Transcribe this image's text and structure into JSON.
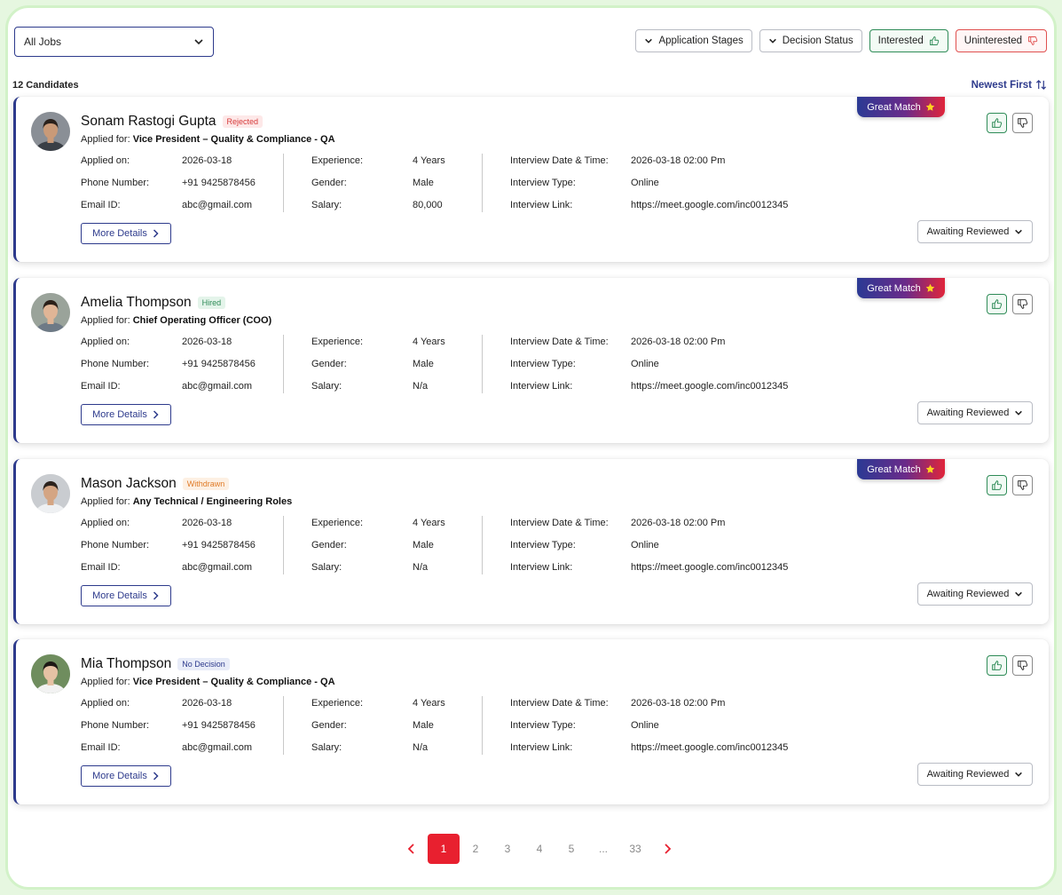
{
  "toolbar": {
    "jobs_select": "All Jobs",
    "application_stages": "Application Stages",
    "decision_status": "Decision Status",
    "interested": "Interested",
    "uninterested": "Uninterested"
  },
  "list": {
    "count": "12 Candidates",
    "sort": "Newest First"
  },
  "labels": {
    "applied_for": "Applied for: ",
    "applied_on": "Applied on:",
    "phone": "Phone Number:",
    "email": "Email ID:",
    "experience": "Experience:",
    "gender": "Gender:",
    "salary": "Salary:",
    "interview_dt": "Interview Date & Time:",
    "interview_type": "Interview Type:",
    "interview_link": "Interview Link:",
    "more_details": "More Details",
    "great_match": "Great Match",
    "awaiting": "Awaiting Reviewed"
  },
  "candidates": [
    {
      "name": "Sonam Rastogi Gupta",
      "status": "Rejected",
      "applied_for": "Vice President – Quality & Compliance - QA",
      "applied_on": "2026-03-18",
      "phone": "+91 9425878456",
      "email": "abc@gmail.com",
      "experience": "4 Years",
      "gender": "Male",
      "salary": "80,000",
      "interview_dt": "2026-03-18 02:00 Pm",
      "interview_type": "Online",
      "interview_link": "https://meet.google.com/inc0012345",
      "great_match": true
    },
    {
      "name": "Amelia Thompson",
      "status": "Hired",
      "applied_for": "Chief Operating Officer (COO)",
      "applied_on": "2026-03-18",
      "phone": "+91 9425878456",
      "email": "abc@gmail.com",
      "experience": "4 Years",
      "gender": "Male",
      "salary": "N/a",
      "interview_dt": "2026-03-18 02:00 Pm",
      "interview_type": "Online",
      "interview_link": "https://meet.google.com/inc0012345",
      "great_match": true
    },
    {
      "name": "Mason Jackson",
      "status": "Withdrawn",
      "applied_for": "Any Technical / Engineering Roles",
      "applied_on": "2026-03-18",
      "phone": "+91 9425878456",
      "email": "abc@gmail.com",
      "experience": "4 Years",
      "gender": "Male",
      "salary": "N/a",
      "interview_dt": "2026-03-18 02:00 Pm",
      "interview_type": "Online",
      "interview_link": "https://meet.google.com/inc0012345",
      "great_match": true
    },
    {
      "name": "Mia Thompson",
      "status": "No Decision",
      "applied_for": "Vice President – Quality & Compliance - QA",
      "applied_on": "2026-03-18",
      "phone": "+91 9425878456",
      "email": "abc@gmail.com",
      "experience": "4 Years",
      "gender": "Male",
      "salary": "N/a",
      "interview_dt": "2026-03-18 02:00 Pm",
      "interview_type": "Online",
      "interview_link": "https://meet.google.com/inc0012345",
      "great_match": false
    }
  ],
  "pagination": {
    "pages": [
      "1",
      "2",
      "3",
      "4",
      "5",
      "...",
      "33"
    ],
    "active": "1"
  },
  "colors": {
    "accent": "#2d3a8c",
    "danger": "#e8202f",
    "success": "#2e8b57"
  }
}
